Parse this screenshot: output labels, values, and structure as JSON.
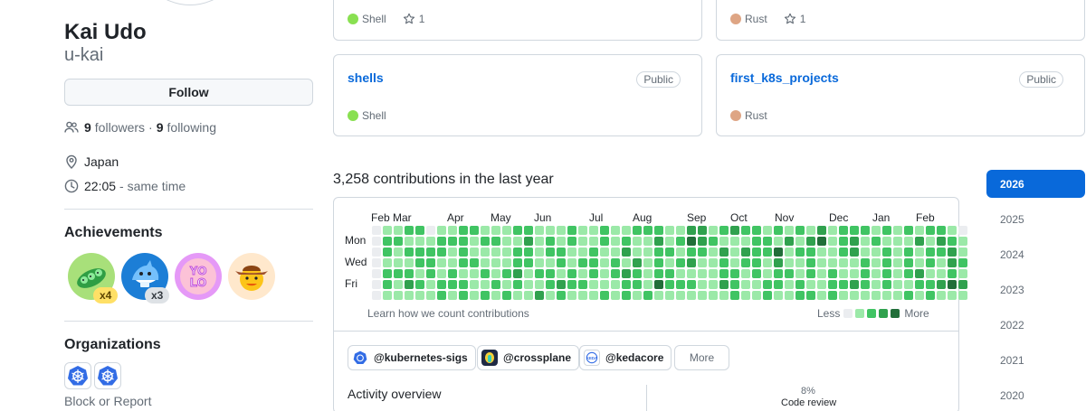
{
  "profile": {
    "name": "Kai Udo",
    "login": "u-kai",
    "follow_label": "Follow",
    "followers_count": "9",
    "followers_label": "followers",
    "dot": "·",
    "following_count": "9",
    "following_label": "following",
    "location": "Japan",
    "local_time": "22:05",
    "time_suffix": "- same time"
  },
  "achievements": {
    "title": "Achievements",
    "badges": [
      {
        "icon": "peas-badge-icon",
        "count": "x4"
      },
      {
        "icon": "shark-badge-icon",
        "count": "x3"
      },
      {
        "icon": "yolo-badge-icon",
        "count": ""
      },
      {
        "icon": "cowboy-badge-icon",
        "count": ""
      }
    ]
  },
  "organizations": {
    "title": "Organizations",
    "items": [
      {
        "icon": "kubernetes-icon"
      },
      {
        "icon": "kubernetes-icon"
      }
    ],
    "block_label": "Block or Report"
  },
  "repos": [
    {
      "name": "",
      "visibility": "",
      "language": "Shell",
      "language_color": "#89e051",
      "stars": "1"
    },
    {
      "name": "",
      "visibility": "",
      "language": "Rust",
      "language_color": "#dea584",
      "stars": "1"
    },
    {
      "name": "shells",
      "visibility": "Public",
      "language": "Shell",
      "language_color": "#89e051",
      "stars": ""
    },
    {
      "name": "first_k8s_projects",
      "visibility": "Public",
      "language": "Rust",
      "language_color": "#dea584",
      "stars": ""
    }
  ],
  "contributions": {
    "title": "3,258 contributions in the last year",
    "months": [
      "Feb",
      "Mar",
      "Apr",
      "May",
      "Jun",
      "Jul",
      "Aug",
      "Sep",
      "Oct",
      "Nov",
      "Dec",
      "Jan",
      "Feb"
    ],
    "days": [
      "Mon",
      "Wed",
      "Fri"
    ],
    "learn_label": "Learn how we count contributions",
    "legend_less": "Less",
    "legend_more": "More",
    "level_colors": [
      "#ebedf0",
      "#9be9a8",
      "#40c463",
      "#30a14e",
      "#216e39"
    ],
    "levels": [
      "0112201122111221112112112221133123221212131222121212210",
      "0221112221221131212112121131243211122131341231211131321",
      "0212222121111221221121131122122131322412211231121212231",
      "0111221122111221121221213121231121221311211112121212132",
      "0222121211212312212121232122111122121221212112121231121",
      "0213212221121211232211122142221132112212112232121122343",
      "0111112121212113121112121211111112112112212111111212111"
    ]
  },
  "activity_orgs": [
    {
      "label": "@kubernetes-sigs",
      "icon": "kubernetes-sigs-icon"
    },
    {
      "label": "@crossplane",
      "icon": "crossplane-icon"
    },
    {
      "label": "@kedacore",
      "icon": "kedacore-icon"
    }
  ],
  "more_label": "More",
  "activity": {
    "title": "Activity overview",
    "percent": "8%",
    "label": "Code review"
  },
  "years": [
    "2026",
    "2025",
    "2024",
    "2023",
    "2022",
    "2021",
    "2020"
  ],
  "active_year": "2026"
}
